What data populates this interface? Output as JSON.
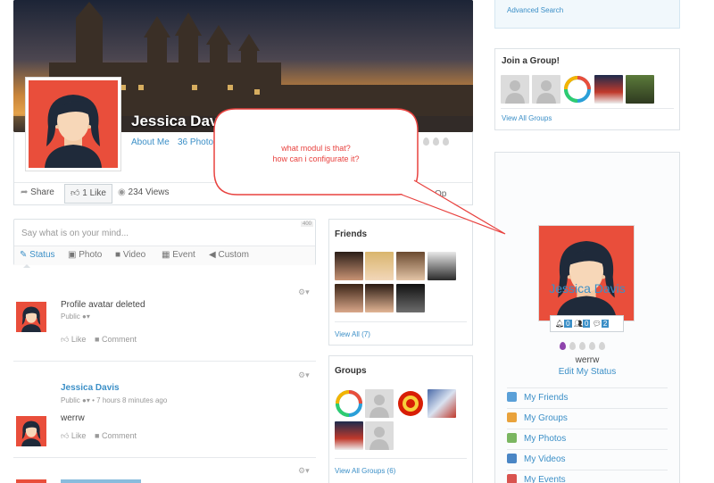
{
  "profile": {
    "name": "Jessica Davis",
    "tabs": [
      "About Me",
      "36 Photo"
    ],
    "share_label": "Share",
    "like_label": "1 Like",
    "views_label": "234 Views",
    "options_label": "Op"
  },
  "status_box": {
    "placeholder": "Say what is on your mind...",
    "char_count": "400",
    "tabs": [
      "Status",
      "Photo",
      "Video",
      "Event",
      "Custom"
    ]
  },
  "feed": [
    {
      "text": "Profile avatar deleted",
      "privacy": "Public",
      "actions": [
        "Like",
        "Comment"
      ]
    },
    {
      "author": "Jessica Davis",
      "privacy": "Public",
      "time": "7 hours 8 minutes ago",
      "text": "werrw",
      "actions": [
        "Like",
        "Comment"
      ]
    }
  ],
  "friends": {
    "title": "Friends",
    "view_all": "View All (7)"
  },
  "groups": {
    "title": "Groups",
    "view_all": "View All Groups (6)"
  },
  "search": {
    "advanced": "Advanced Search"
  },
  "join_group": {
    "title": "Join a Group!",
    "view_all": "View All Groups"
  },
  "sidebar_profile": {
    "name": "Jessica Davis",
    "counts": [
      "0",
      "0",
      "2"
    ],
    "status": "werrw",
    "edit_status": "Edit My Status",
    "menu": [
      "My Friends",
      "My Groups",
      "My Photos",
      "My Videos",
      "My Events"
    ]
  },
  "annotation": {
    "line1": "what modul is that?",
    "line2": "how can i configurate it?"
  },
  "colors": {
    "accent": "#3b8fc7",
    "avatar_bg": "#e94e3b",
    "annotation": "#e8423f"
  }
}
